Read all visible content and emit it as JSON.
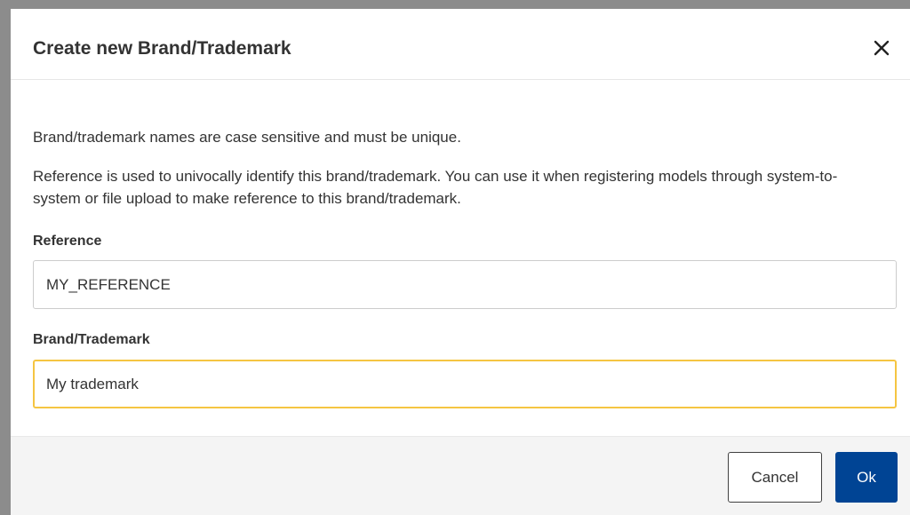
{
  "dialog": {
    "title": "Create new Brand/Trademark",
    "close_icon": "close-icon",
    "info_text_1": "Brand/trademark names are case sensitive and must be unique.",
    "info_text_2": "Reference is used to univocally identify this brand/trademark. You can use it when registering models through system-to-system or file upload to make reference to this brand/trademark."
  },
  "form": {
    "reference": {
      "label": "Reference",
      "value": "MY_REFERENCE"
    },
    "brand": {
      "label": "Brand/Trademark",
      "value": "My trademark"
    }
  },
  "footer": {
    "cancel_label": "Cancel",
    "ok_label": "Ok"
  },
  "colors": {
    "primary": "#004494",
    "focus_border": "#f5c542",
    "backdrop": "#8c8c8c"
  }
}
